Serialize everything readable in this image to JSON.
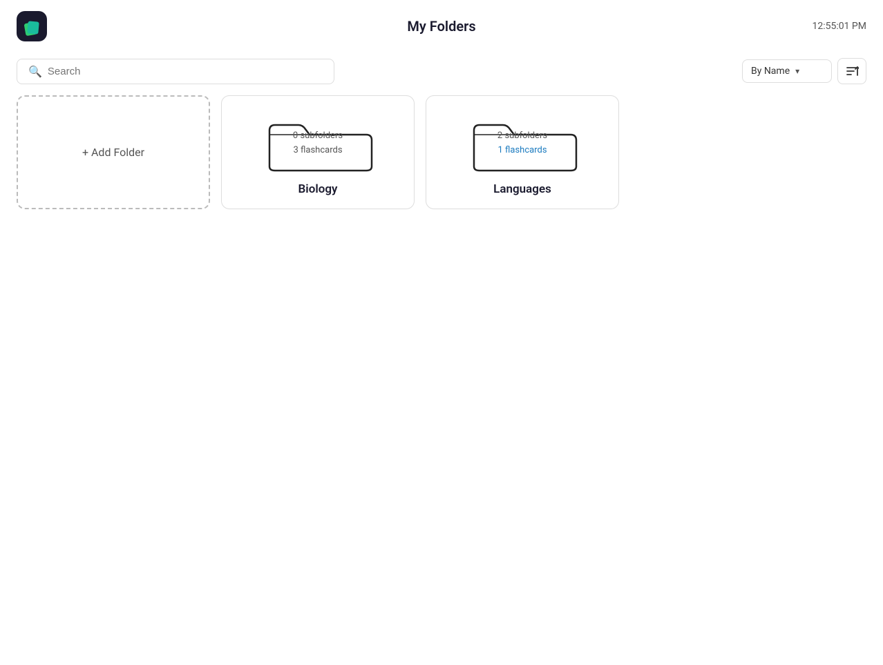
{
  "header": {
    "title": "My Folders",
    "time": "12:55:01 PM",
    "logo_alt": "App Logo"
  },
  "toolbar": {
    "search_placeholder": "Search",
    "sort_label": "By Name",
    "sort_icon_label": "sort-icon"
  },
  "add_folder": {
    "label": "+ Add Folder"
  },
  "folders": [
    {
      "name": "Biology",
      "subfolders": "0 subfolders",
      "flashcards": "3 flashcards"
    },
    {
      "name": "Languages",
      "subfolders": "2 subfolders",
      "flashcards": "1 flashcards"
    }
  ]
}
